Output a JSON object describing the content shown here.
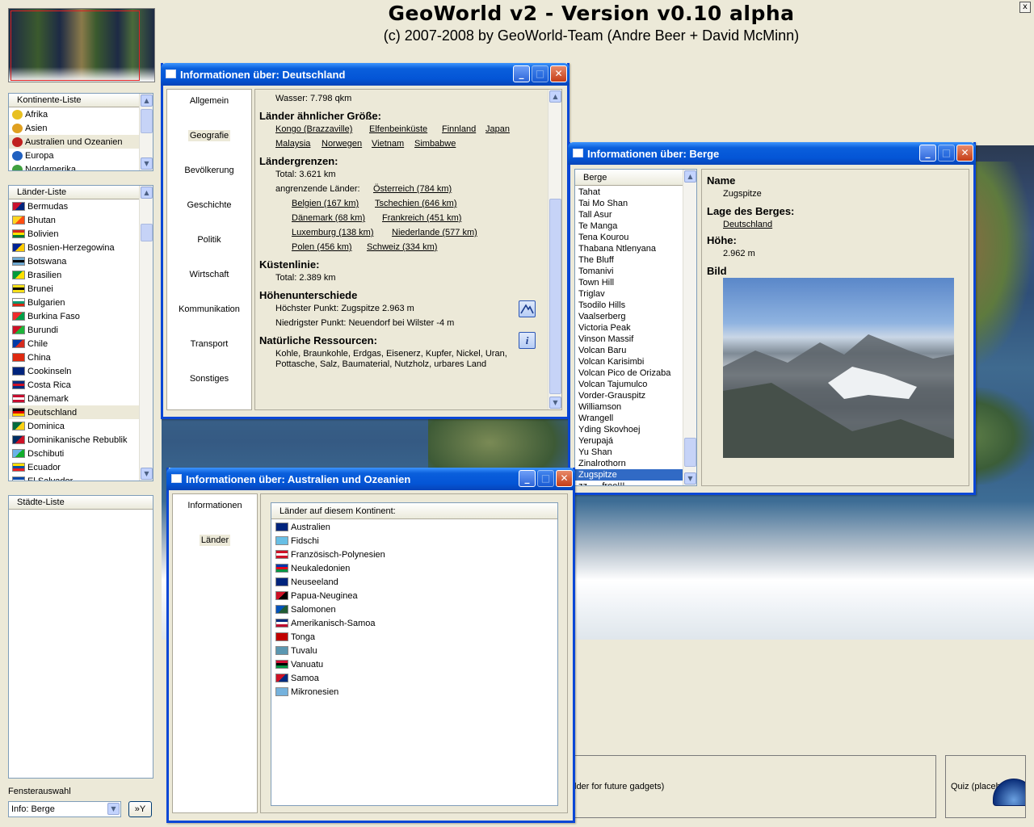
{
  "app": {
    "title": "GeoWorld v2 - Version v0.10 alpha",
    "subtitle": "(c) 2007-2008 by GeoWorld-Team (Andre Beer + David McMinn)",
    "close_label": "x"
  },
  "continents": {
    "header": "Kontinente-Liste",
    "items": [
      "Afrika",
      "Asien",
      "Australien und Ozeanien",
      "Europa",
      "Nordamerika"
    ],
    "selected": "Australien und Ozeanien"
  },
  "countries": {
    "header": "Länder-Liste",
    "items": [
      {
        "name": "Bermudas",
        "colors": [
          "#c8102e",
          "#00247d"
        ]
      },
      {
        "name": "Bhutan",
        "colors": [
          "#ffd520",
          "#ff4e12"
        ]
      },
      {
        "name": "Bolivien",
        "colors": [
          "#d52b1e",
          "#f9e300",
          "#007934"
        ]
      },
      {
        "name": "Bosnien-Herzegowina",
        "colors": [
          "#002395",
          "#fecb00"
        ]
      },
      {
        "name": "Botswana",
        "colors": [
          "#6da9d2",
          "#000000",
          "#6da9d2"
        ]
      },
      {
        "name": "Brasilien",
        "colors": [
          "#009b3a",
          "#fedf00"
        ]
      },
      {
        "name": "Brunei",
        "colors": [
          "#f7e017",
          "#000000",
          "#f7e017"
        ]
      },
      {
        "name": "Bulgarien",
        "colors": [
          "#ffffff",
          "#00966e",
          "#d62612"
        ]
      },
      {
        "name": "Burkina Faso",
        "colors": [
          "#ef2b2d",
          "#009e49"
        ]
      },
      {
        "name": "Burundi",
        "colors": [
          "#ce1126",
          "#1eb53a"
        ]
      },
      {
        "name": "Chile",
        "colors": [
          "#0039a6",
          "#d52b1e"
        ]
      },
      {
        "name": "China",
        "colors": [
          "#de2910",
          "#de2910"
        ]
      },
      {
        "name": "Cookinseln",
        "colors": [
          "#00247d",
          "#00247d"
        ]
      },
      {
        "name": "Costa Rica",
        "colors": [
          "#002b7f",
          "#ce1126",
          "#002b7f"
        ]
      },
      {
        "name": "Dänemark",
        "colors": [
          "#c60c30",
          "#ffffff",
          "#c60c30"
        ]
      },
      {
        "name": "Deutschland",
        "colors": [
          "#000000",
          "#dd0000",
          "#ffce00"
        ]
      },
      {
        "name": "Dominica",
        "colors": [
          "#006b3f",
          "#fcd116"
        ]
      },
      {
        "name": "Dominikanische Rebublik",
        "colors": [
          "#002d62",
          "#ce1126"
        ]
      },
      {
        "name": "Dschibuti",
        "colors": [
          "#6ab2e7",
          "#12ad2b"
        ]
      },
      {
        "name": "Ecuador",
        "colors": [
          "#ffdd00",
          "#034ea2",
          "#ed1c24"
        ]
      },
      {
        "name": "El Salvador",
        "colors": [
          "#0047ab",
          "#ffffff",
          "#0047ab"
        ]
      }
    ],
    "selected": "Deutschland"
  },
  "cities": {
    "header": "Städte-Liste"
  },
  "window_select": {
    "label": "Fensterauswahl",
    "value": "Info: Berge",
    "button": "»Y"
  },
  "germany_window": {
    "title": "Informationen über: Deutschland",
    "tabs": [
      "Allgemein",
      "Geografie",
      "Bevölkerung",
      "Geschichte",
      "Politik",
      "Wirtschaft",
      "Kommunikation",
      "Transport",
      "Sonstiges"
    ],
    "active_tab": "Geografie",
    "water": "Wasser:  7.798 qkm",
    "similar_size_heading": "Länder ähnlicher Größe:",
    "similar_size": [
      "Kongo (Brazzaville)",
      "Elfenbeinküste",
      "Finnland",
      "Japan",
      "Malaysia",
      "Norwegen",
      "Vietnam",
      "Simbabwe"
    ],
    "borders_heading": "Ländergrenzen:",
    "borders_total": "Total:  3.621 km",
    "neighbors_label": "angrenzende Länder:",
    "neighbors": [
      "Österreich (784 km)",
      "Belgien (167 km)",
      "Tschechien (646 km)",
      "Dänemark (68 km)",
      "Frankreich (451 km)",
      "Luxemburg (138 km)",
      "Niederlande (577 km)",
      "Polen (456 km)",
      "Schweiz (334 km)"
    ],
    "coast_heading": "Küstenlinie:",
    "coast_total": "Total:  2.389 km",
    "elevation_heading": "Höhenunterschiede",
    "highest": "Höchster Punkt: Zugspitze 2.963 m",
    "lowest": "Niedrigster Punkt: Neuendorf bei Wilster -4 m",
    "resources_heading": "Natürliche Ressourcen:",
    "resources_line1": "Kohle, Braunkohle, Erdgas, Eisenerz, Kupfer, Nickel, Uran,",
    "resources_line2": "Pottasche, Salz, Baumaterial, Nutzholz, urbares Land",
    "info_icon_label": "i"
  },
  "mountains_window": {
    "title": "Informationen über: Berge",
    "list_header": "Berge",
    "items": [
      "Tahat",
      "Tai Mo Shan",
      "Tall Asur",
      "Te Manga",
      "Tena Kourou",
      "Thabana Ntlenyana",
      "The Bluff",
      "Tomanivi",
      "Town Hill",
      "Triglav",
      "Tsodilo Hills",
      "Vaalserberg",
      "Victoria Peak",
      "Vinson Massif",
      "Volcan Baru",
      "Volcan Karisimbi",
      "Volcan Pico de Orizaba",
      "Volcan Tajumulco",
      "Vorder-Grauspitz",
      "Williamson",
      "Wrangell",
      "Yding Skovhoej",
      "Yerupajá",
      "Yu Shan",
      "Zinalrothorn",
      "Zugspitze",
      "zz___free!!!"
    ],
    "selected": "Zugspitze",
    "name_label": "Name",
    "name_value": "Zugspitze",
    "location_label": "Lage des Berges:",
    "location_value": "Deutschland",
    "height_label": "Höhe:",
    "height_value": "2.962 m",
    "image_label": "Bild"
  },
  "oceania_window": {
    "title": "Informationen über: Australien und Ozeanien",
    "tabs": [
      "Informationen",
      "Länder"
    ],
    "active_tab": "Länder",
    "list_header": "Länder auf diesem Kontinent:",
    "countries": [
      {
        "name": "Australien",
        "colors": [
          "#00247d",
          "#00247d"
        ]
      },
      {
        "name": "Fidschi",
        "colors": [
          "#68bfe5",
          "#68bfe5"
        ]
      },
      {
        "name": "Französisch-Polynesien",
        "colors": [
          "#ce1126",
          "#ffffff",
          "#ce1126"
        ]
      },
      {
        "name": "Neukaledonien",
        "colors": [
          "#0035ad",
          "#e5001a",
          "#009543"
        ]
      },
      {
        "name": "Neuseeland",
        "colors": [
          "#00247d",
          "#00247d"
        ]
      },
      {
        "name": "Papua-Neuginea",
        "colors": [
          "#ce1126",
          "#000000"
        ]
      },
      {
        "name": "Salomonen",
        "colors": [
          "#0051ba",
          "#215b33"
        ]
      },
      {
        "name": "Amerikanisch-Samoa",
        "colors": [
          "#002b7f",
          "#ffffff",
          "#bf0a30"
        ]
      },
      {
        "name": "Tonga",
        "colors": [
          "#c10000",
          "#c10000"
        ]
      },
      {
        "name": "Tuvalu",
        "colors": [
          "#5b97b1",
          "#5b97b1"
        ]
      },
      {
        "name": "Vanuatu",
        "colors": [
          "#d21034",
          "#000000",
          "#009543"
        ]
      },
      {
        "name": "Samoa",
        "colors": [
          "#ce1126",
          "#002b7f"
        ]
      },
      {
        "name": "Mikronesien",
        "colors": [
          "#75b2dd",
          "#75b2dd"
        ]
      }
    ]
  },
  "gadgets": {
    "placeholder_text": "lder for future gadgets)",
    "quiz_text": "Quiz (placeh"
  }
}
